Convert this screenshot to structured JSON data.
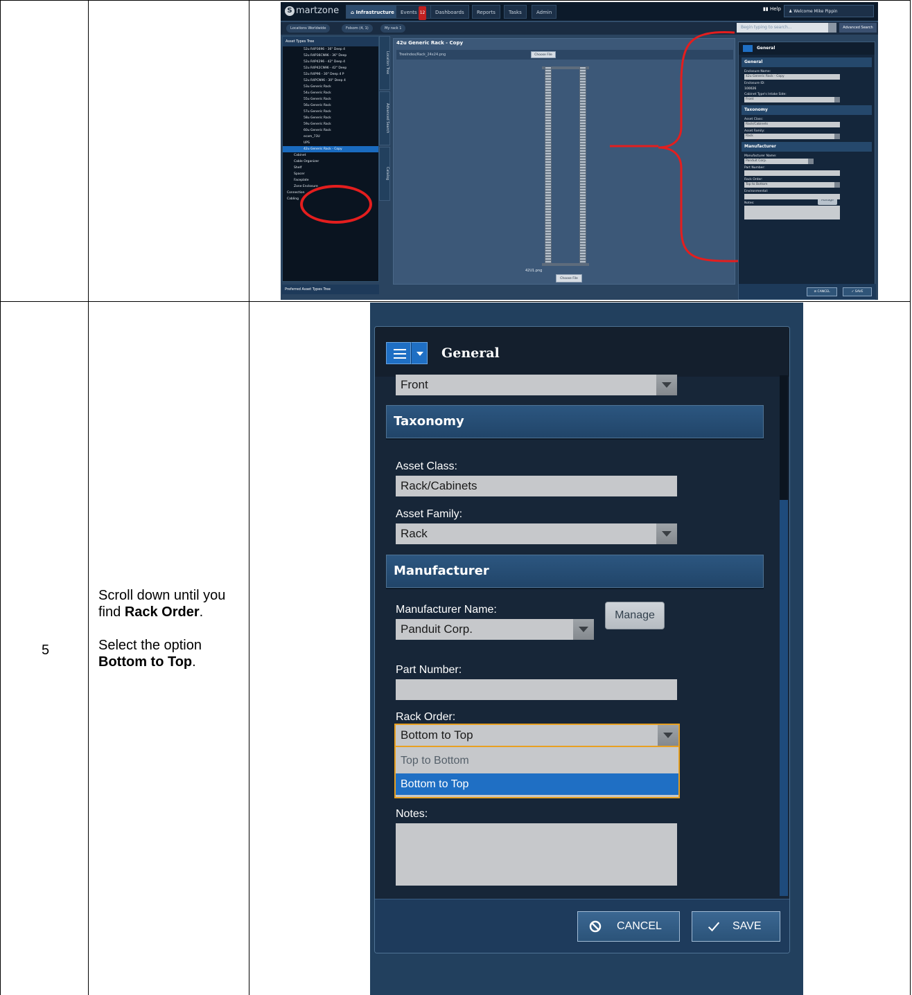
{
  "step": {
    "number": "5",
    "instr_part1": "Scroll down until you find ",
    "instr_bold1": "Rack Order",
    "instr_part2": ".",
    "instr_part3": "Select the option ",
    "instr_bold2": "Bottom to Top",
    "instr_part4": "."
  },
  "overview": {
    "logo": "martzone",
    "tabs": [
      "Infrastructure",
      "Events",
      "Dashboards",
      "Reports",
      "Tasks",
      "Admin"
    ],
    "events_badge": "12",
    "help": "Help",
    "welcome": "Welcome Mike Pippin",
    "breadcrumbs": [
      "Locations Worldwide",
      "Folsom (4, 1)",
      "My rack 1"
    ],
    "search_placeholder": "Begin typing to search...",
    "advanced_search": "Advanced Search",
    "left_panel_title": "Asset Types Tree",
    "tree_items": [
      "52u R4P3696 - 36\" Deep 4",
      "52u R4P36CN96 - 36\" Deep",
      "52u R4P4296 - 42\" Deep 4",
      "52u R4P42CN96 - 42\" Deep",
      "52u R4P96 - 30\" Deep 4 P",
      "52u R4PCN96 - 30\" Deep 4",
      "53u Generic Rack",
      "54u Generic Rack",
      "55u Generic Rack",
      "56u Generic Rack",
      "57u Generic Rack",
      "58u Generic Rack",
      "59u Generic Rack",
      "60u Generic Rack",
      "ecam_73U",
      "UPS",
      "42u Generic Rack - Copy",
      "Cabinet",
      "Cable Organizer",
      "Shelf",
      "Spacer",
      "Faceplate",
      "Zone Enclosure",
      "Connection",
      "Cabling"
    ],
    "side_tabs": [
      "Location Tree",
      "Advanced Search",
      "Catalog"
    ],
    "left_footer": "Preferred Asset Types Tree",
    "center_title": "42u Generic Rack - Copy",
    "center_file": "TreeIndex/Rack_24x24.png",
    "choose_file": "Choose File",
    "rack_image_name": "42U1.png",
    "right_title": "General",
    "r_sections": [
      "General",
      "Taxonomy",
      "Manufacturer"
    ],
    "r_enclosure_name_lbl": "Enclosure Name:",
    "r_enclosure_name": "42u Generic Rack - Copy",
    "r_enclosure_id_lbl": "Enclosure ID:",
    "r_enclosure_id": "100026",
    "r_intake_lbl": "Cabinet Type's Intake Side:",
    "r_intake": "Front",
    "r_asset_class_lbl": "Asset Class:",
    "r_asset_class": "Rack/Cabinets",
    "r_asset_family_lbl": "Asset Family:",
    "r_asset_family": "Rack",
    "r_mfr_lbl": "Manufacturer Name:",
    "r_mfr": "Panduit Corp.",
    "r_manage": "Manage",
    "r_part_lbl": "Part Number:",
    "r_rack_order_lbl": "Rack Order:",
    "r_rack_order": "Top to Bottom",
    "r_env_lbl": "Environmental:",
    "r_notes_lbl": "Notes:",
    "r_cancel": "CANCEL",
    "r_save": "SAVE"
  },
  "panel": {
    "title": "General",
    "intake_value": "Front",
    "taxonomy": "Taxonomy",
    "asset_class_label": "Asset Class:",
    "asset_class_value": "Rack/Cabinets",
    "asset_family_label": "Asset Family:",
    "asset_family_value": "Rack",
    "manufacturer": "Manufacturer",
    "manufacturer_name_label": "Manufacturer Name:",
    "manufacturer_name_value": "Panduit Corp.",
    "manage": "Manage",
    "part_number_label": "Part Number:",
    "part_number_value": "",
    "rack_order_label": "Rack Order:",
    "rack_order_value": "Bottom to Top",
    "rack_order_options": [
      "Top to Bottom",
      "Bottom to Top"
    ],
    "notes_label": "Notes:",
    "cancel": "CANCEL",
    "save": "SAVE"
  },
  "colors": {
    "accent": "#1f6fc4",
    "focus_border": "#e8a020",
    "annotation_red": "#e41e1e"
  }
}
